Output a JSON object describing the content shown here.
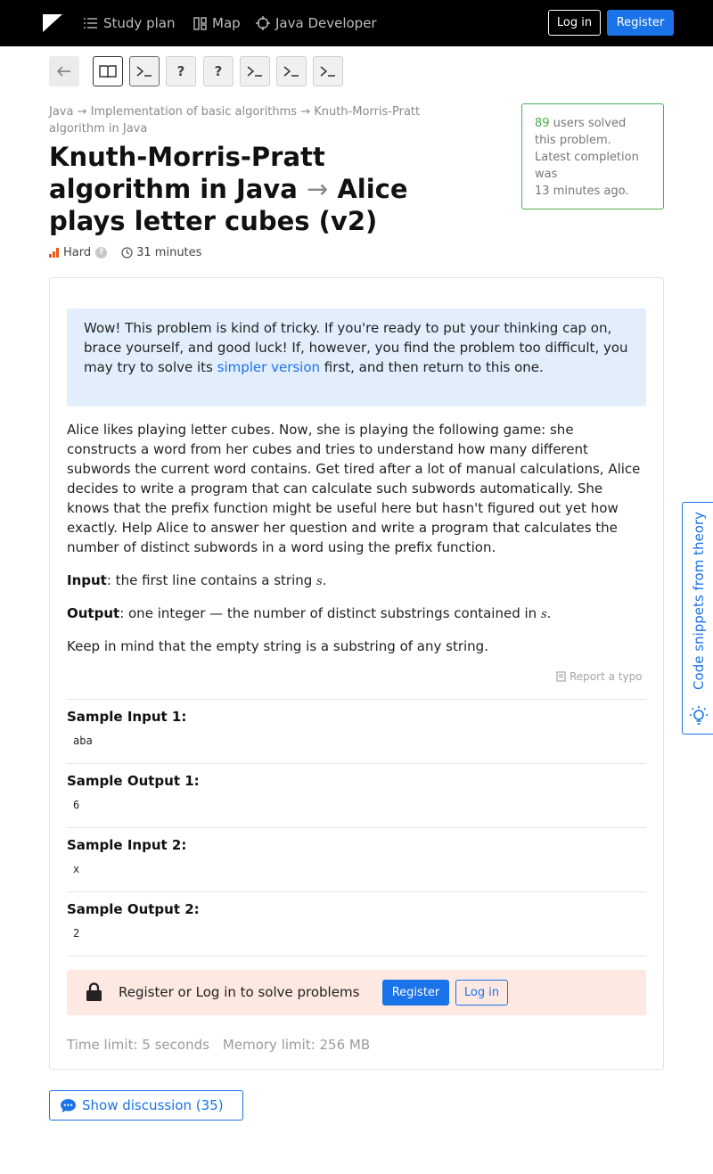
{
  "topbar": {
    "logo": "hyperskill-logo",
    "nav": [
      {
        "label": "Study plan",
        "icon": "list-icon"
      },
      {
        "label": "Map",
        "icon": "map-icon"
      },
      {
        "label": "Java Developer",
        "icon": "target-icon"
      }
    ],
    "login_label": "Log in",
    "register_label": "Register"
  },
  "stages": {
    "buttons": [
      {
        "icon": "back-arrow-icon"
      },
      {
        "icon": "book-icon"
      },
      {
        "icon": "terminal-icon",
        "state": "current"
      },
      {
        "icon": "question-icon",
        "text": "?"
      },
      {
        "icon": "question-icon",
        "text": "?"
      },
      {
        "icon": "terminal-icon"
      },
      {
        "icon": "terminal-icon"
      },
      {
        "icon": "terminal-icon"
      }
    ]
  },
  "breadcrumb": {
    "items": [
      "Java",
      "Implementation of basic algorithms",
      "Knuth-Morris-Pratt algorithm in Java"
    ],
    "separator": "→"
  },
  "title": {
    "topic": "Knuth-Morris-Pratt algorithm in Java",
    "arrow": "→",
    "problem": "Alice plays letter cubes (v2)"
  },
  "meta": {
    "difficulty": "Hard",
    "help": "?",
    "time": "31 minutes"
  },
  "solved": {
    "count": "89",
    "text_after_count": " users solved this problem. Latest completion was",
    "last": "13 minutes ago."
  },
  "alert": {
    "text_before": "Wow! This problem is kind of tricky. If you're ready to put your thinking cap on, brace yourself, and good luck! If, however, you find the problem too difficult, you may try to solve its ",
    "link": "simpler version",
    "text_after": " first, and then return to this one."
  },
  "description": {
    "body": "Alice likes playing letter cubes. Now, she is playing the following game: she constructs a word from her cubes and tries to understand how many different subwords the current word contains. Get tired after a lot of manual calculations, Alice decides to write a program that can calculate such subwords automatically. She knows that the prefix function might be useful here but hasn't figured out yet how exactly. Help Alice to answer her question and write a program that calculates the number of distinct subwords in a word using the prefix function.",
    "input_label": "Input",
    "input_text": ": the first line contains a string ",
    "output_label": "Output",
    "output_text": ": one integer — the number of distinct substrings contained in ",
    "var": "s",
    "period": ".",
    "note": "Keep in mind that the empty string is a substring of any string."
  },
  "report_typo": "Report a typo",
  "samples": [
    {
      "label": "Sample Input 1:",
      "value": "aba"
    },
    {
      "label": "Sample Output 1:",
      "value": "6"
    },
    {
      "label": "Sample Input 2:",
      "value": "x"
    },
    {
      "label": "Sample Output 2:",
      "value": "2"
    }
  ],
  "locked": {
    "text": "Register or Log in to solve problems",
    "register_label": "Register",
    "login_label": "Log in"
  },
  "limits": {
    "time": "Time limit: 5 seconds",
    "memory": "Memory limit: 256 MB"
  },
  "discussion": {
    "label": "Show discussion (35)"
  },
  "side_tab": {
    "label": "Code snippets from theory"
  },
  "colors": {
    "accent": "#1a73e8",
    "success": "#4caf50",
    "difficulty": "#e8591a",
    "alert_bg": "#e3eefc",
    "locked_bg": "#fde8e2"
  }
}
